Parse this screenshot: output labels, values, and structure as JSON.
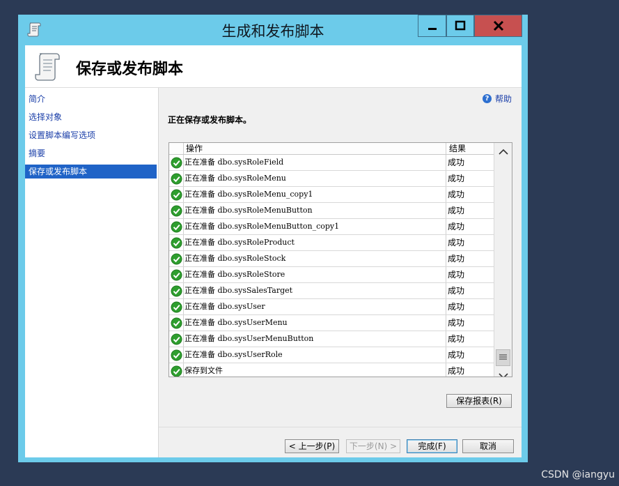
{
  "window": {
    "title": "生成和发布脚本",
    "minimize_icon": "minimize-icon",
    "maximize_icon": "maximize-icon",
    "close_icon": "close-icon"
  },
  "header": {
    "title": "保存或发布脚本",
    "icon": "script-scroll-icon"
  },
  "nav": {
    "items": [
      {
        "label": "简介",
        "selected": false
      },
      {
        "label": "选择对象",
        "selected": false
      },
      {
        "label": "设置脚本编写选项",
        "selected": false
      },
      {
        "label": "摘要",
        "selected": false
      },
      {
        "label": "保存或发布脚本",
        "selected": true
      }
    ]
  },
  "help": {
    "label": "帮助",
    "icon": "help-icon"
  },
  "status_text": "正在保存或发布脚本。",
  "grid": {
    "columns": [
      "操作",
      "结果"
    ],
    "rows": [
      {
        "op": "正在准备 dbo.sysRoleField",
        "result": "成功"
      },
      {
        "op": "正在准备 dbo.sysRoleMenu",
        "result": "成功"
      },
      {
        "op": "正在准备 dbo.sysRoleMenu_copy1",
        "result": "成功"
      },
      {
        "op": "正在准备 dbo.sysRoleMenuButton",
        "result": "成功"
      },
      {
        "op": "正在准备 dbo.sysRoleMenuButton_copy1",
        "result": "成功"
      },
      {
        "op": "正在准备 dbo.sysRoleProduct",
        "result": "成功"
      },
      {
        "op": "正在准备 dbo.sysRoleStock",
        "result": "成功"
      },
      {
        "op": "正在准备 dbo.sysRoleStore",
        "result": "成功"
      },
      {
        "op": "正在准备 dbo.sysSalesTarget",
        "result": "成功"
      },
      {
        "op": "正在准备 dbo.sysUser",
        "result": "成功"
      },
      {
        "op": "正在准备 dbo.sysUserMenu",
        "result": "成功"
      },
      {
        "op": "正在准备 dbo.sysUserMenuButton",
        "result": "成功"
      },
      {
        "op": "正在准备 dbo.sysUserRole",
        "result": "成功"
      },
      {
        "op": "保存到文件",
        "result": "成功"
      }
    ],
    "status_icon": "success-check-icon",
    "success_color": "#2e9e2e"
  },
  "buttons": {
    "save_report": "保存报表(R)",
    "prev": "< 上一步(P)",
    "next": "下一步(N) >",
    "finish": "完成(F)",
    "cancel": "取消"
  },
  "watermark": "CSDN @iangyu",
  "colors": {
    "window_frame": "#6ccbea",
    "close_button": "#c75050",
    "nav_selected": "#1f63c7",
    "link": "#1a3ea8"
  }
}
